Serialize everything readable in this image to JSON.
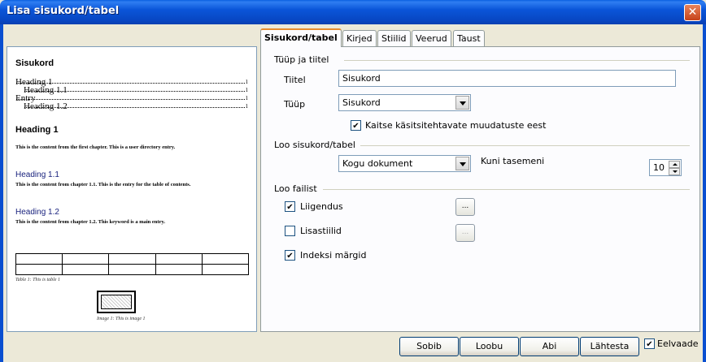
{
  "window": {
    "title": "Lisa sisukord/tabel",
    "close_glyph": "✕"
  },
  "tabs": [
    {
      "label": "Sisukord/tabel",
      "active": true
    },
    {
      "label": "Kirjed",
      "active": false
    },
    {
      "label": "Stiilid",
      "active": false
    },
    {
      "label": "Veerud",
      "active": false
    },
    {
      "label": "Taust",
      "active": false
    }
  ],
  "preview": {
    "toc_title": "Sisukord",
    "toc_entries": [
      {
        "label": "Heading 1",
        "page": "1"
      },
      {
        "label": "Heading 1.1",
        "page": "1"
      },
      {
        "label": "Entry",
        "page": "1"
      },
      {
        "label": "Heading 1.2",
        "page": "1"
      }
    ],
    "heading1": "Heading 1",
    "body1": "This is the content from the first chapter. This is a user directory entry.",
    "heading11": "Heading 1.1",
    "body11": "This is the content from chapter 1.1. This is the entry for the table of contents.",
    "heading12": "Heading 1.2",
    "body12": "This is the content from chapter 1.2. This keyword is a main entry.",
    "table_caption": "Table 1: This is table 1",
    "image_caption": "Image 1: This is image 1"
  },
  "type_title": {
    "section": "Tüüp ja tiitel",
    "title_label": "Tiitel",
    "title_value": "Sisukord",
    "type_label": "Tüüp",
    "type_value": "Sisukord",
    "protect_label": "Kaitse käsitsitehtavate muudatuste eest",
    "protect_checked": true
  },
  "create": {
    "section": "Loo sisukord/tabel",
    "scope_value": "Kogu dokument",
    "level_label": "Kuni tasemeni",
    "level_value": "10"
  },
  "create_from": {
    "section": "Loo failist",
    "outline_label": "Liigendus",
    "outline_checked": true,
    "extra_styles_label": "Lisastiilid",
    "extra_styles_checked": false,
    "index_marks_label": "Indeksi märgid",
    "index_marks_checked": true,
    "dots_button": "..."
  },
  "buttons": {
    "ok": "Sobib",
    "cancel": "Loobu",
    "help": "Abi",
    "reset": "Lähtesta",
    "preview_label": "Eelvaade",
    "preview_checked": true
  }
}
